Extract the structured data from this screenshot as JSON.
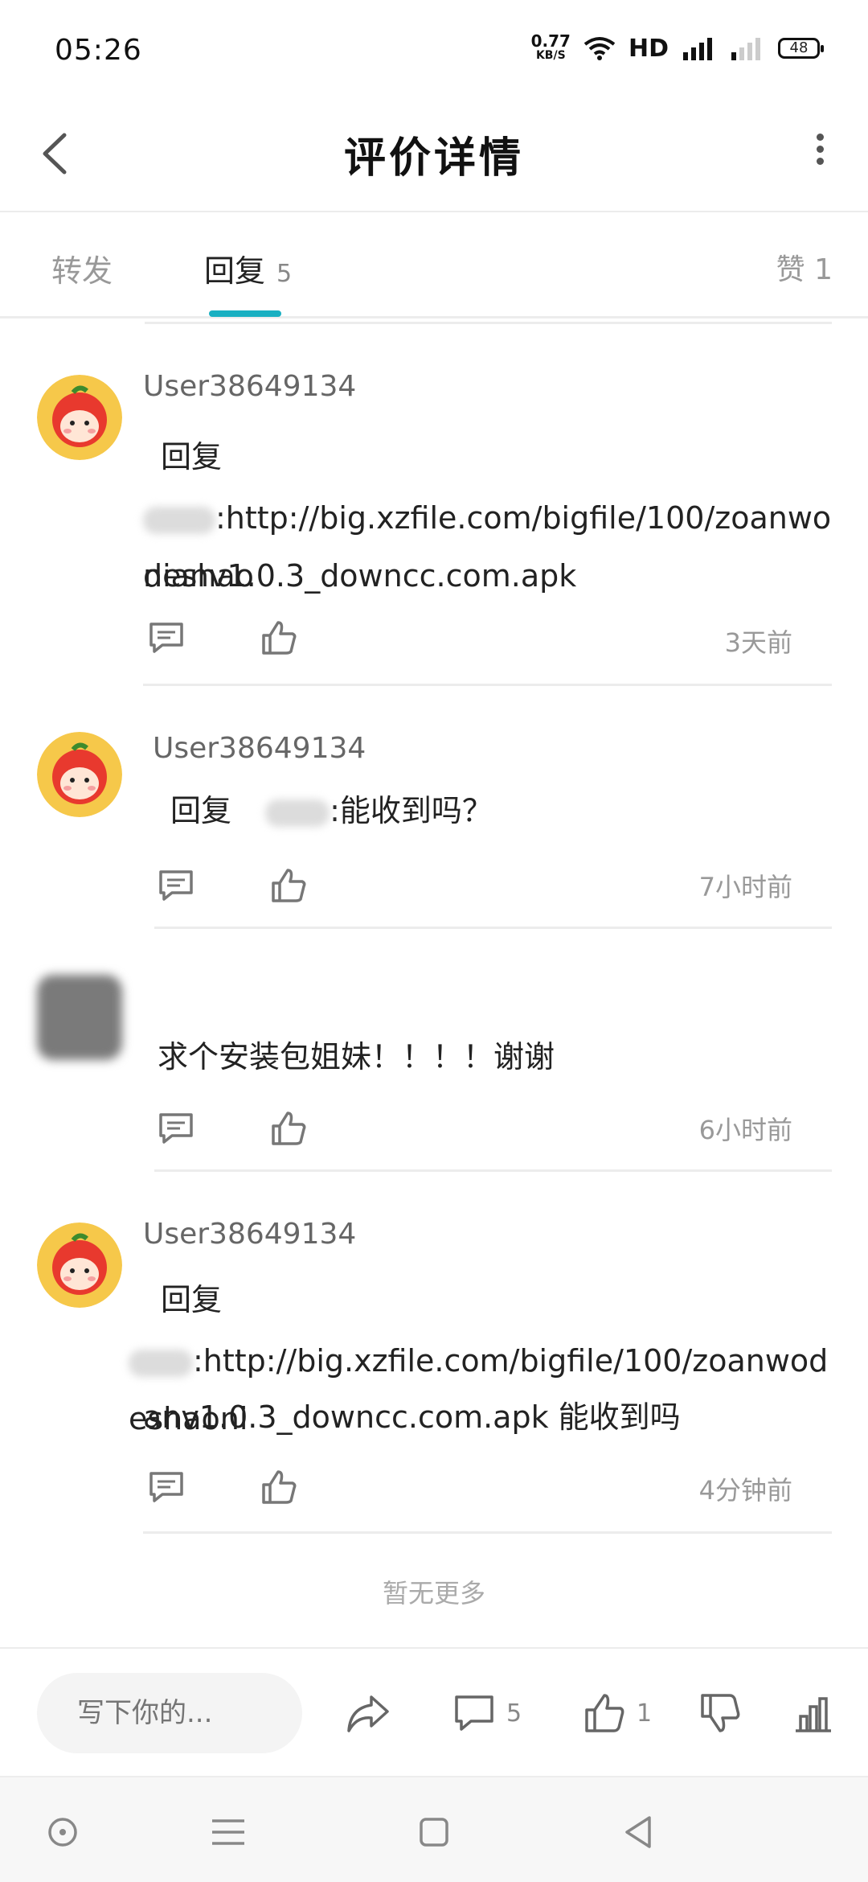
{
  "status_bar": {
    "time": "05:26",
    "net_speed": "0.77",
    "net_unit": "KB/S",
    "hd_label": "HD",
    "battery": "48"
  },
  "header": {
    "title": "评价详情"
  },
  "tabs": {
    "forward_label": "转发",
    "reply_label": "回复",
    "reply_count": "5",
    "like_label": "赞 1"
  },
  "comments": [
    {
      "username": "User38649134",
      "line1": "回复",
      "line2": ":http://big.xzfile.com/bigfile/100/zoanwodeshao",
      "line3": "nianv1.0.3_downcc.com.apk",
      "time": "3天前"
    },
    {
      "username": "User38649134",
      "line1_prefix": "回复",
      "line1_suffix": ":能收到吗？",
      "time": "7小时前"
    },
    {
      "username": "",
      "line1": "求个安装包姐妹！！！！谢谢",
      "time": "6小时前"
    },
    {
      "username": "User38649134",
      "line1": "回复",
      "line2": ":http://big.xzfile.com/bigfile/100/zoanwodeshaoni",
      "line3": "anv1.0.3_downcc.com.apk 能收到吗",
      "time": "4分钟前"
    }
  ],
  "no_more_text": "暂无更多",
  "toolbar": {
    "input_placeholder": "写下你的...",
    "comment_count": "5",
    "like_count": "1"
  },
  "colors": {
    "accent": "#19b0c2",
    "avatar_red": "#e8392e",
    "avatar_yellow": "#f6c84a"
  }
}
